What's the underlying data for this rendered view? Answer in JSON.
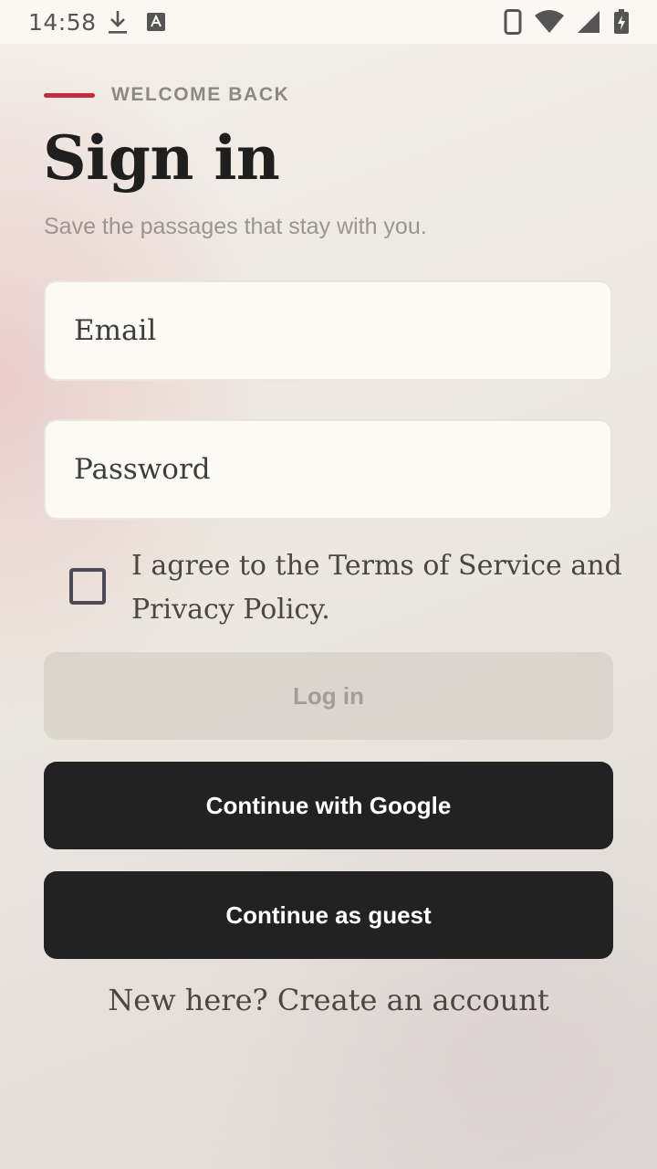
{
  "status_bar": {
    "time": "14:58",
    "left_icons": [
      "download-icon",
      "a-badge-icon"
    ],
    "right_icons": [
      "phone-icon",
      "wifi-icon",
      "signal-icon",
      "battery-charging-icon"
    ]
  },
  "header": {
    "eyebrow": "WELCOME BACK",
    "title": "Sign in",
    "subtitle": "Save the passages that stay with you."
  },
  "form": {
    "email_placeholder": "Email",
    "password_placeholder": "Password",
    "agree_checked": false,
    "agree_text": "I agree to the Terms of Service and Privacy Policy."
  },
  "buttons": {
    "login": "Log in",
    "google": "Continue with Google",
    "guest": "Continue as guest"
  },
  "footer": {
    "create_account": "New here? Create an account"
  },
  "colors": {
    "accent": "#c12d3c",
    "primary_button": "#222222",
    "disabled_button_text": "#a29d98"
  }
}
